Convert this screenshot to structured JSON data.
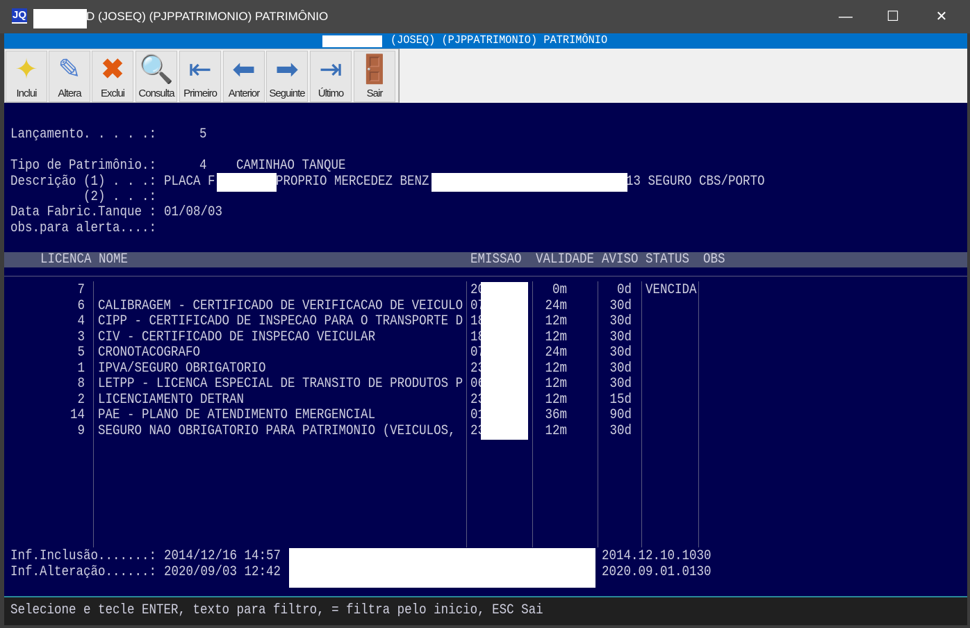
{
  "window": {
    "title": "D (JOSEQ) (PJPPATRIMONIO) PATRIMÔNIO",
    "logo": "JQ",
    "minimize": "—",
    "maximize": "☐",
    "close": "✕"
  },
  "app_bar": {
    "title": "(JOSEQ) (PJPPATRIMONIO) PATRIMÔNIO"
  },
  "toolbar": [
    {
      "label": "Inclui",
      "icon": "star-icon"
    },
    {
      "label": "Altera",
      "icon": "edit-icon"
    },
    {
      "label": "Exclui",
      "icon": "delete-icon"
    },
    {
      "label": "Consulta",
      "icon": "search-icon"
    },
    {
      "label": "Primeiro",
      "icon": "first-icon"
    },
    {
      "label": "Anterior",
      "icon": "previous-icon"
    },
    {
      "label": "Seguinte",
      "icon": "next-icon"
    },
    {
      "label": "Último",
      "icon": "last-icon"
    },
    {
      "label": "Sair",
      "icon": "exit-icon"
    }
  ],
  "form": {
    "lancamento_label": "Lançamento. . . . .:",
    "lancamento": "5",
    "tipo_label": "Tipo de Patrimônio.:",
    "tipo_code": "4",
    "tipo_name": "CAMINHAO TANQUE",
    "desc1_label": "Descrição (1) . . .:",
    "desc1_a": "PLACA F",
    "desc1_b": "PROPRIO MERCEDEZ BENZ",
    "desc1_c": "13 SEGURO CBS/PORTO",
    "desc2_label": "(2) . . .:",
    "data_label": "Data Fabric.Tanque :",
    "data": "01/08/03",
    "obs_label": "obs.para alerta....:"
  },
  "table": {
    "headers": {
      "licenca": "LICENCA",
      "nome": "NOME",
      "emissao": "EMISSAO",
      "validade": "VALIDADE",
      "aviso": "AVISO",
      "status": "STATUS",
      "obs": "OBS"
    },
    "rows": [
      {
        "licenca": "7",
        "nome": "",
        "emissao": "20",
        "validade": "0m",
        "aviso": "0d",
        "status": "VENCIDA"
      },
      {
        "licenca": "6",
        "nome": "CALIBRAGEM - CERTIFICADO DE VERIFICACAO DE VEICULO",
        "emissao": "07",
        "validade": "24m",
        "aviso": "30d",
        "status": ""
      },
      {
        "licenca": "4",
        "nome": "CIPP - CERTIFICADO DE INSPECAO PARA O TRANSPORTE D",
        "emissao": "18",
        "validade": "12m",
        "aviso": "30d",
        "status": ""
      },
      {
        "licenca": "3",
        "nome": "CIV - CERTIFICADO DE INSPECAO VEICULAR",
        "emissao": "18",
        "validade": "12m",
        "aviso": "30d",
        "status": ""
      },
      {
        "licenca": "5",
        "nome": "CRONOTACOGRAFO",
        "emissao": "07",
        "validade": "24m",
        "aviso": "30d",
        "status": ""
      },
      {
        "licenca": "1",
        "nome": "IPVA/SEGURO OBRIGATORIO",
        "emissao": "23",
        "validade": "12m",
        "aviso": "30d",
        "status": ""
      },
      {
        "licenca": "8",
        "nome": "LETPP - LICENCA ESPECIAL DE TRANSITO DE PRODUTOS P",
        "emissao": "06",
        "validade": "12m",
        "aviso": "30d",
        "status": ""
      },
      {
        "licenca": "2",
        "nome": "LICENCIAMENTO DETRAN",
        "emissao": "23",
        "validade": "12m",
        "aviso": "15d",
        "status": ""
      },
      {
        "licenca": "14",
        "nome": "PAE - PLANO DE ATENDIMENTO EMERGENCIAL",
        "emissao": "01",
        "validade": "36m",
        "aviso": "90d",
        "status": ""
      },
      {
        "licenca": "9",
        "nome": "SEGURO NAO OBRIGATORIO PARA PATRIMONIO (VEICULOS,",
        "emissao": "23",
        "validade": "12m",
        "aviso": "30d",
        "status": ""
      }
    ]
  },
  "footer": {
    "inclusao_label": "Inf.Inclusão.......:",
    "inclusao": "2014/12/16 14:57",
    "inclusao_ver": "2014.12.10.1030",
    "alteracao_label": "Inf.Alteração......:",
    "alteracao": "2020/09/03 12:42",
    "alteracao_ver": "2020.09.01.0130"
  },
  "status_bar": "Selecione e tecle ENTER, texto para filtro, = filtra pelo inicio, ESC Sai"
}
